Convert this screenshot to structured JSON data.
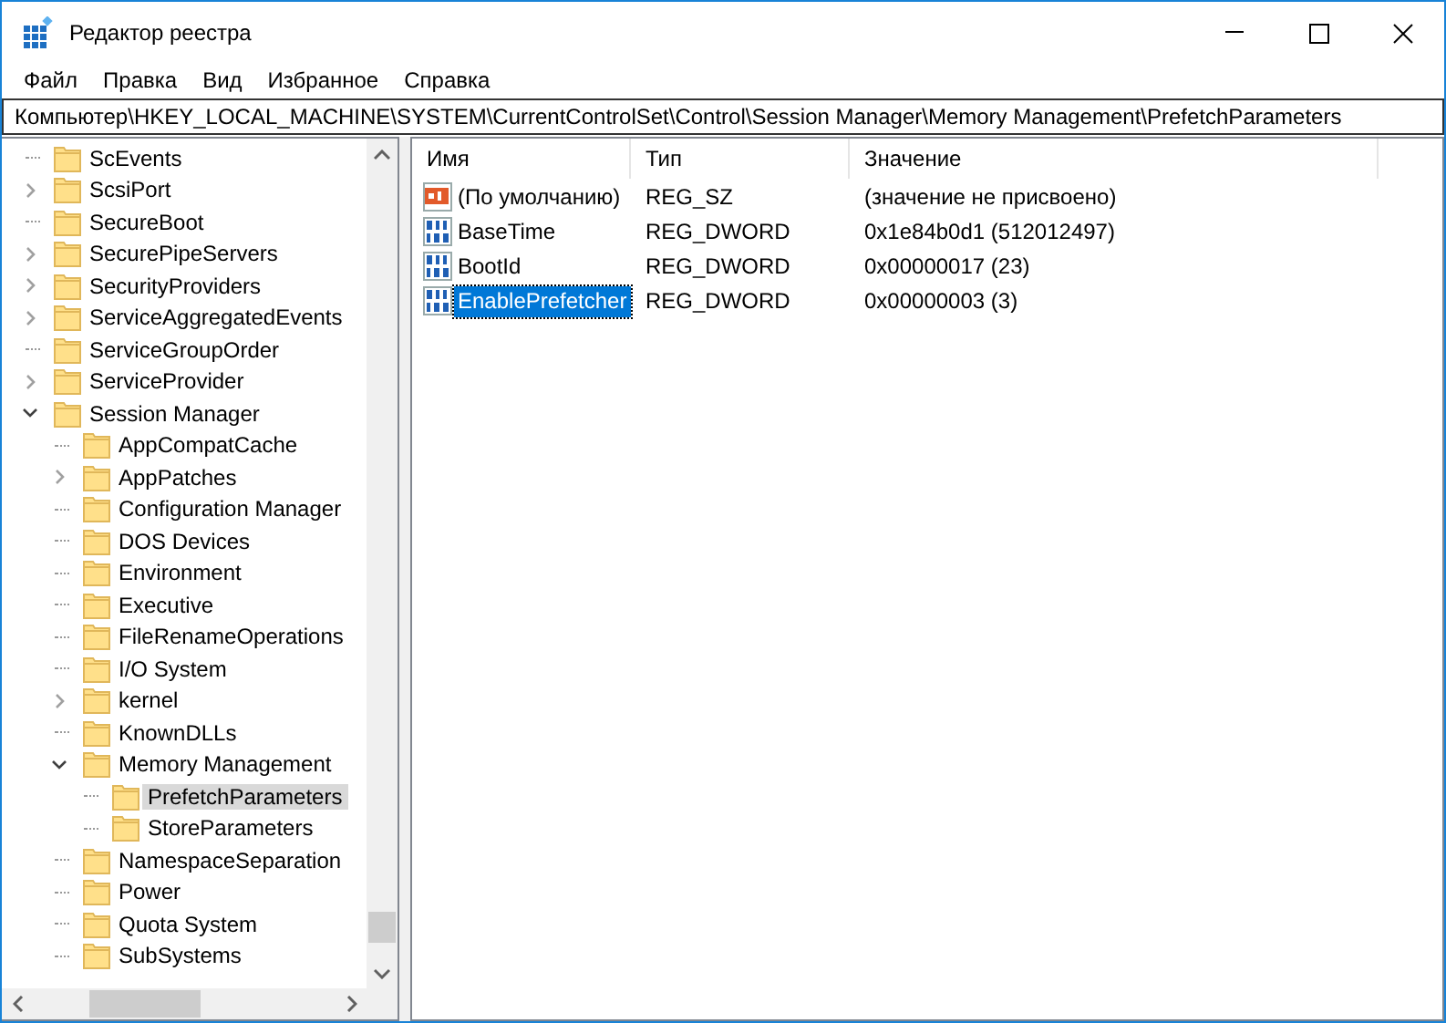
{
  "window": {
    "title": "Редактор реестра"
  },
  "menu": [
    "Файл",
    "Правка",
    "Вид",
    "Избранное",
    "Справка"
  ],
  "address": "Компьютер\\HKEY_LOCAL_MACHINE\\SYSTEM\\CurrentControlSet\\Control\\Session Manager\\Memory Management\\PrefetchParameters",
  "tree": [
    {
      "label": "ScEvents",
      "expandable": false,
      "expanded": false,
      "selected": false
    },
    {
      "label": "ScsiPort",
      "expandable": true,
      "expanded": false,
      "selected": false
    },
    {
      "label": "SecureBoot",
      "expandable": false,
      "expanded": false,
      "selected": false
    },
    {
      "label": "SecurePipeServers",
      "expandable": true,
      "expanded": false,
      "selected": false
    },
    {
      "label": "SecurityProviders",
      "expandable": true,
      "expanded": false,
      "selected": false
    },
    {
      "label": "ServiceAggregatedEvents",
      "expandable": true,
      "expanded": false,
      "selected": false
    },
    {
      "label": "ServiceGroupOrder",
      "expandable": false,
      "expanded": false,
      "selected": false
    },
    {
      "label": "ServiceProvider",
      "expandable": true,
      "expanded": false,
      "selected": false
    },
    {
      "label": "Session Manager",
      "expandable": true,
      "expanded": true,
      "selected": false,
      "children": [
        {
          "label": "AppCompatCache",
          "expandable": false,
          "expanded": false,
          "selected": false
        },
        {
          "label": "AppPatches",
          "expandable": true,
          "expanded": false,
          "selected": false
        },
        {
          "label": "Configuration Manager",
          "expandable": false,
          "expanded": false,
          "selected": false
        },
        {
          "label": "DOS Devices",
          "expandable": false,
          "expanded": false,
          "selected": false
        },
        {
          "label": "Environment",
          "expandable": false,
          "expanded": false,
          "selected": false
        },
        {
          "label": "Executive",
          "expandable": false,
          "expanded": false,
          "selected": false
        },
        {
          "label": "FileRenameOperations",
          "expandable": false,
          "expanded": false,
          "selected": false
        },
        {
          "label": "I/O System",
          "expandable": false,
          "expanded": false,
          "selected": false
        },
        {
          "label": "kernel",
          "expandable": true,
          "expanded": false,
          "selected": false
        },
        {
          "label": "KnownDLLs",
          "expandable": false,
          "expanded": false,
          "selected": false
        },
        {
          "label": "Memory Management",
          "expandable": true,
          "expanded": true,
          "selected": false,
          "children": [
            {
              "label": "PrefetchParameters",
              "expandable": false,
              "expanded": false,
              "selected": true
            },
            {
              "label": "StoreParameters",
              "expandable": false,
              "expanded": false,
              "selected": false
            }
          ]
        },
        {
          "label": "NamespaceSeparation",
          "expandable": false,
          "expanded": false,
          "selected": false
        },
        {
          "label": "Power",
          "expandable": false,
          "expanded": false,
          "selected": false
        },
        {
          "label": "Quota System",
          "expandable": false,
          "expanded": false,
          "selected": false
        },
        {
          "label": "SubSystems",
          "expandable": false,
          "expanded": false,
          "selected": false
        }
      ]
    }
  ],
  "values": {
    "columns": [
      "Имя",
      "Тип",
      "Значение"
    ],
    "rows": [
      {
        "kind": "string",
        "name": "(По умолчанию)",
        "type": "REG_SZ",
        "data": "(значение не присвоено)",
        "selected": false
      },
      {
        "kind": "binary",
        "name": "BaseTime",
        "type": "REG_DWORD",
        "data": "0x1e84b0d1 (512012497)",
        "selected": false
      },
      {
        "kind": "binary",
        "name": "BootId",
        "type": "REG_DWORD",
        "data": "0x00000017 (23)",
        "selected": false
      },
      {
        "kind": "binary",
        "name": "EnablePrefetcher",
        "type": "REG_DWORD",
        "data": "0x00000003 (3)",
        "selected": true
      }
    ]
  }
}
